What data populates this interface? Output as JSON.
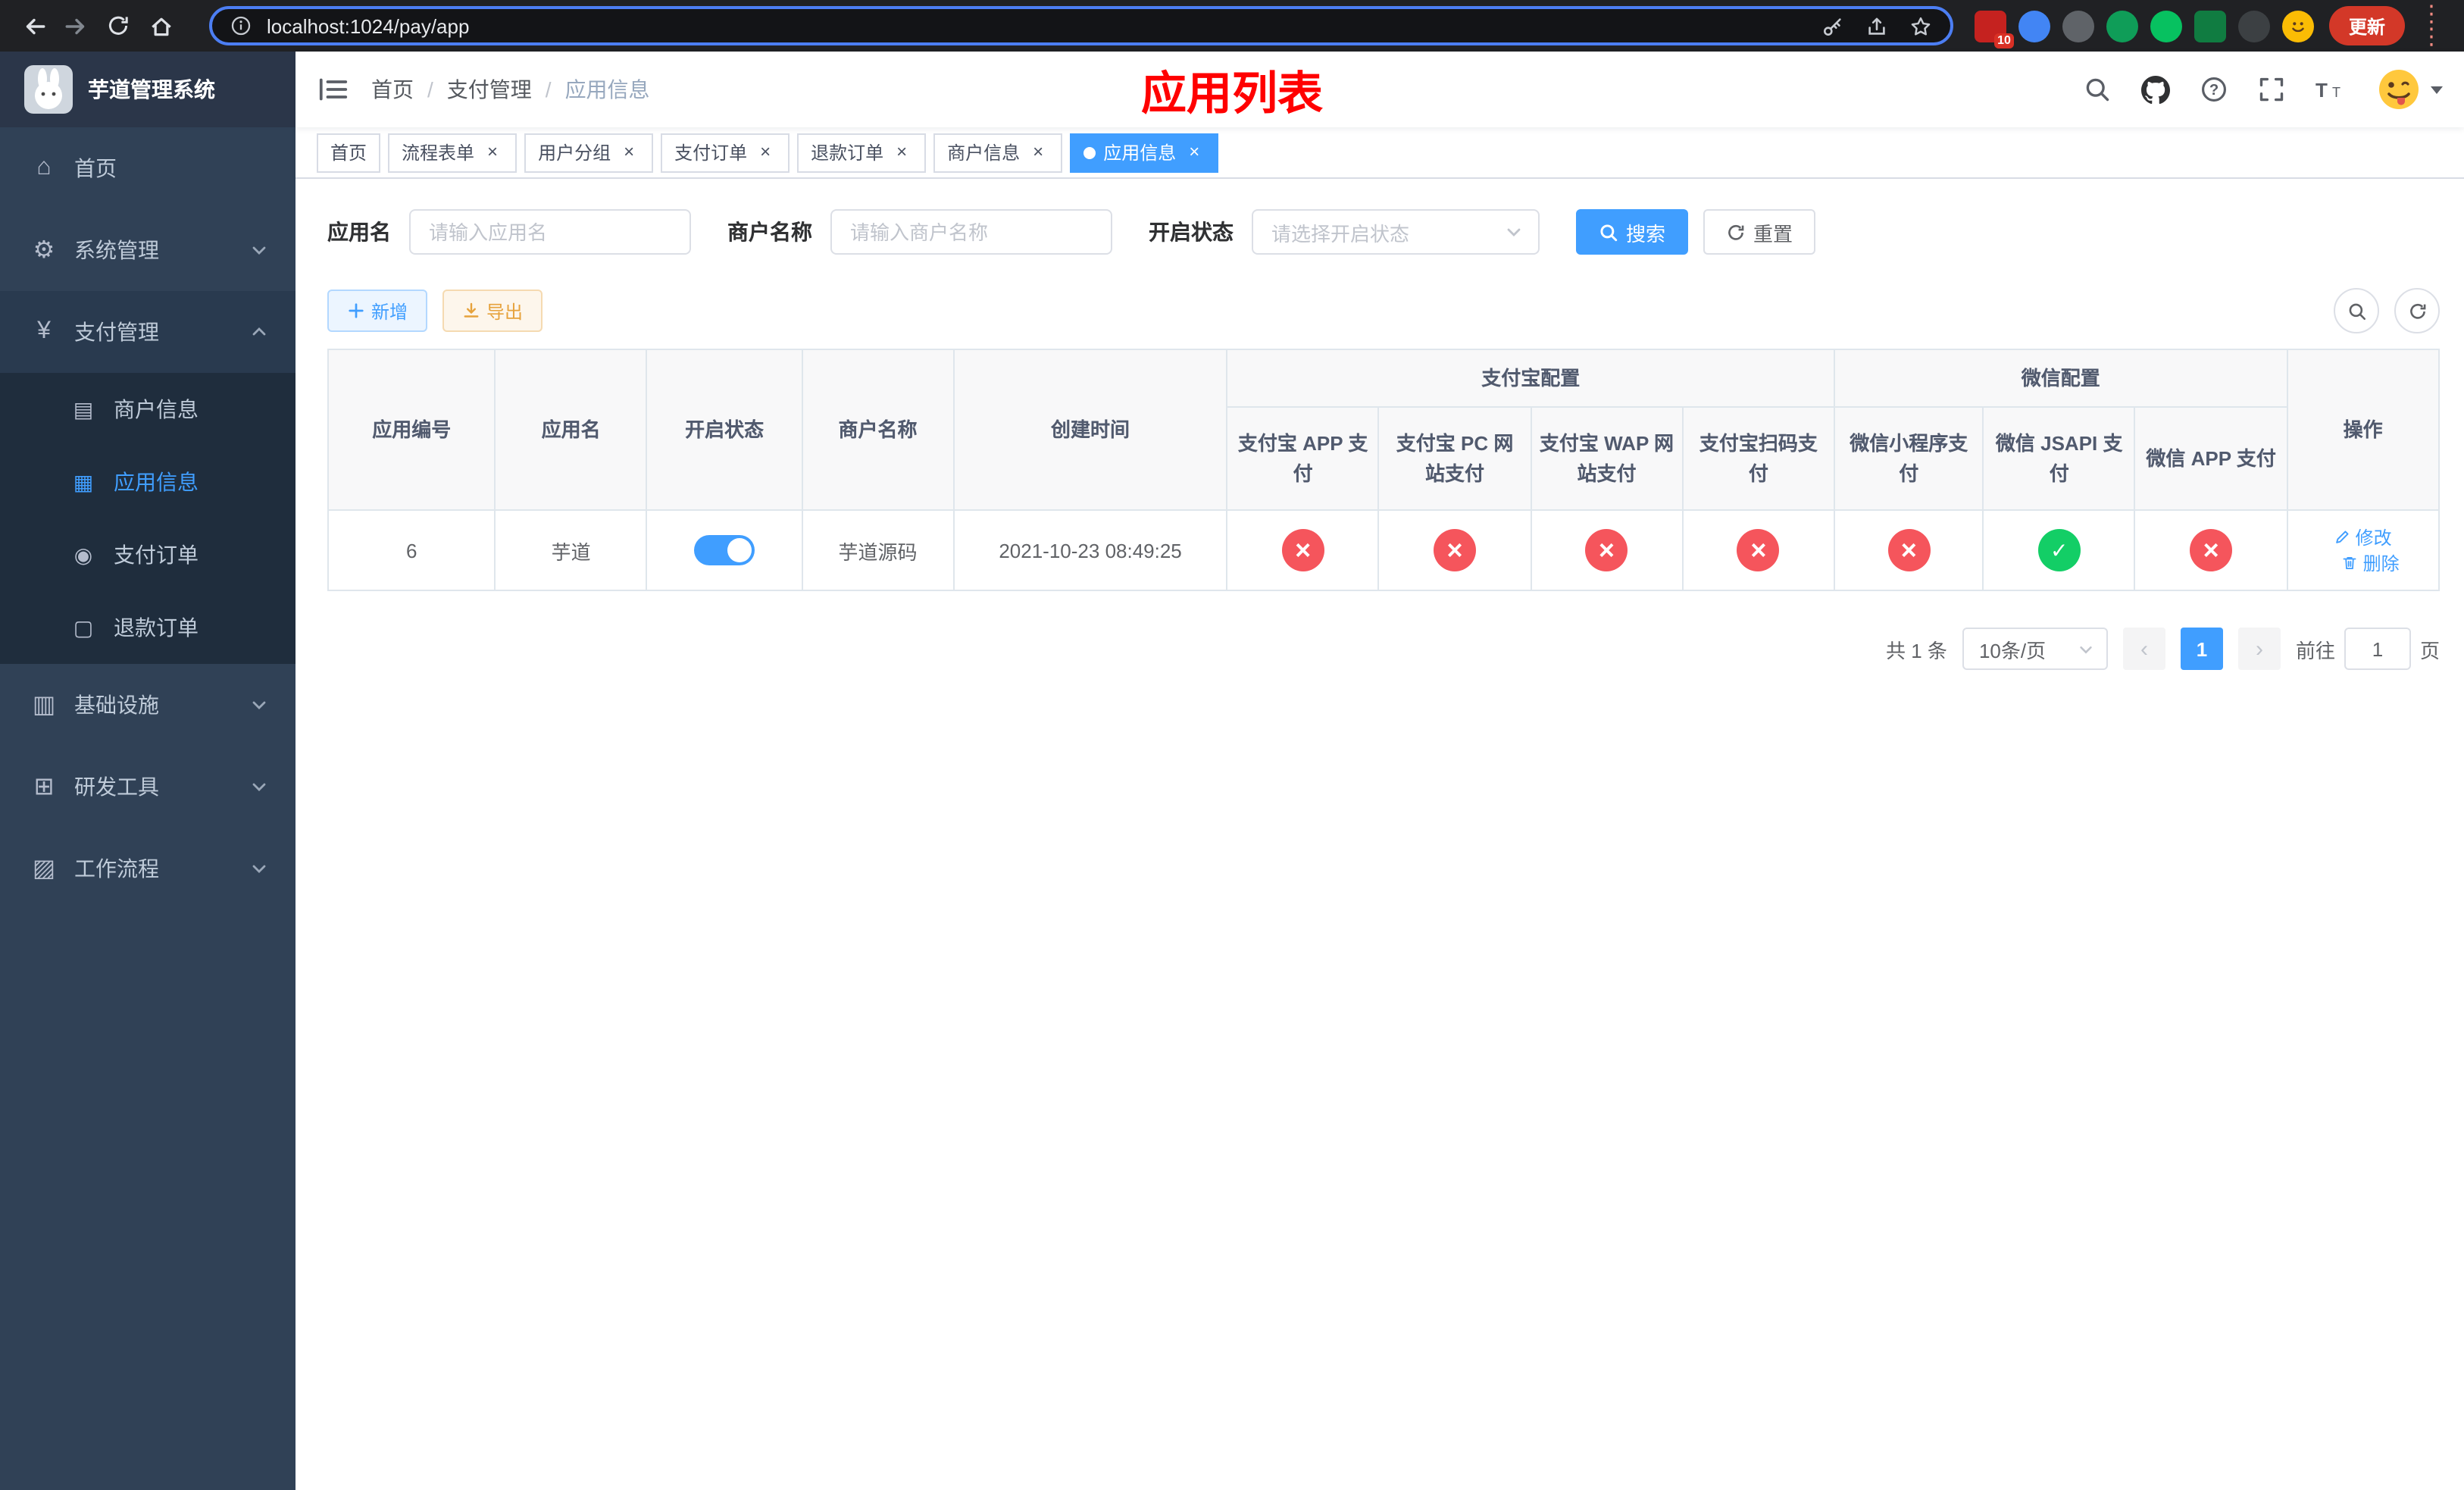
{
  "browser": {
    "url": "localhost:1024/pay/app",
    "update_button_label": "更新",
    "extension_badge": "10"
  },
  "sidebar": {
    "logo_title": "芋道管理系统",
    "items": [
      {
        "label": "首页",
        "icon": "home-icon"
      },
      {
        "label": "系统管理",
        "icon": "gear-icon",
        "expandable": true
      },
      {
        "label": "支付管理",
        "icon": "yen-icon",
        "expandable": true,
        "expanded": true,
        "children": [
          {
            "label": "商户信息",
            "icon": "merchant-card-icon"
          },
          {
            "label": "应用信息",
            "icon": "app-grid-icon",
            "active": true
          },
          {
            "label": "支付订单",
            "icon": "pay-order-icon"
          },
          {
            "label": "退款订单",
            "icon": "refund-order-icon"
          }
        ]
      },
      {
        "label": "基础设施",
        "icon": "infrastructure-icon",
        "expandable": true
      },
      {
        "label": "研发工具",
        "icon": "devtools-icon",
        "expandable": true
      },
      {
        "label": "工作流程",
        "icon": "workflow-icon",
        "expandable": true
      }
    ]
  },
  "header": {
    "breadcrumb": [
      "首页",
      "支付管理",
      "应用信息"
    ],
    "page_title_overlay": "应用列表"
  },
  "tabs": [
    {
      "label": "首页",
      "closable": false,
      "active": false
    },
    {
      "label": "流程表单",
      "closable": true,
      "active": false
    },
    {
      "label": "用户分组",
      "closable": true,
      "active": false
    },
    {
      "label": "支付订单",
      "closable": true,
      "active": false
    },
    {
      "label": "退款订单",
      "closable": true,
      "active": false
    },
    {
      "label": "商户信息",
      "closable": true,
      "active": false
    },
    {
      "label": "应用信息",
      "closable": true,
      "active": true
    }
  ],
  "filters": {
    "app_name_label": "应用名",
    "app_name_placeholder": "请输入应用名",
    "merchant_label": "商户名称",
    "merchant_placeholder": "请输入商户名称",
    "status_label": "开启状态",
    "status_placeholder": "请选择开启状态",
    "search_button": "搜索",
    "reset_button": "重置"
  },
  "toolbar": {
    "add_button": "新增",
    "export_button": "导出"
  },
  "table": {
    "group_headers": {
      "alipay": "支付宝配置",
      "wechat": "微信配置"
    },
    "columns": [
      "应用编号",
      "应用名",
      "开启状态",
      "商户名称",
      "创建时间",
      "支付宝 APP 支付",
      "支付宝 PC 网站支付",
      "支付宝 WAP 网站支付",
      "支付宝扫码支付",
      "微信小程序支付",
      "微信 JSAPI 支付",
      "微信 APP 支付",
      "操作"
    ],
    "rows": [
      {
        "app_id": "6",
        "app_name": "芋道",
        "enabled": true,
        "merchant_name": "芋道源码",
        "created_at": "2021-10-23 08:49:25",
        "alipay_app": false,
        "alipay_pc": false,
        "alipay_wap": false,
        "alipay_qr": false,
        "wechat_mini": false,
        "wechat_jsapi": true,
        "wechat_app": false,
        "edit_label": "修改",
        "delete_label": "删除"
      }
    ]
  },
  "pagination": {
    "total_text": "共 1 条",
    "page_size_text": "10条/页",
    "current_page": "1",
    "goto_prefix": "前往",
    "goto_value": "1",
    "goto_suffix": "页"
  },
  "colors": {
    "primary": "#409eff",
    "danger": "#f5555c",
    "success": "#13ce66",
    "warning": "#e6a23c",
    "sidebar_bg": "#304156",
    "submenu_bg": "#1f2d3d",
    "title_red": "#ff0000"
  }
}
